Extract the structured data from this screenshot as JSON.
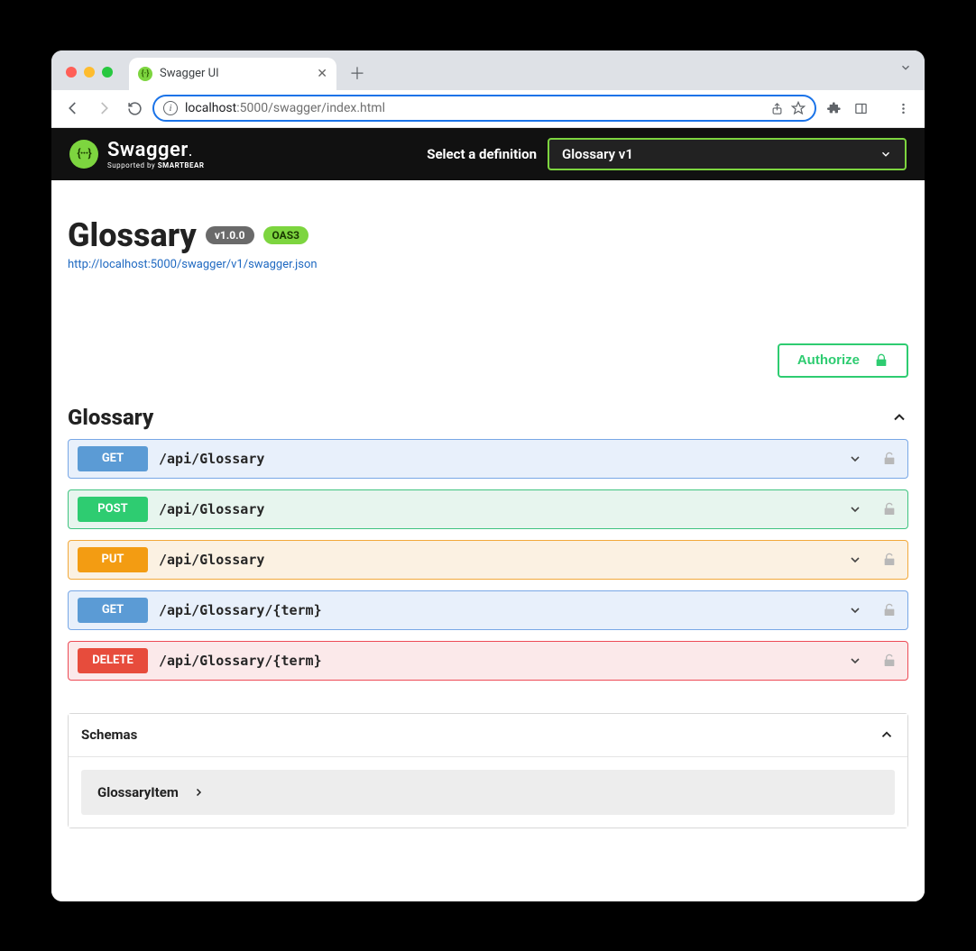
{
  "browser": {
    "tab_title": "Swagger UI",
    "url_host": "localhost",
    "url_port_path": ":5000/swagger/index.html"
  },
  "swagger_topbar": {
    "logo_text": "Swagger",
    "logo_sub_prefix": "Supported by ",
    "logo_sub_brand": "SMARTBEAR",
    "select_label": "Select a definition",
    "selected_definition": "Glossary v1"
  },
  "api": {
    "title": "Glossary",
    "version_badge": "v1.0.0",
    "oas_badge": "OAS3",
    "spec_url": "http://localhost:5000/swagger/v1/swagger.json"
  },
  "authorize_label": "Authorize",
  "tag": {
    "name": "Glossary"
  },
  "operations": [
    {
      "method": "GET",
      "css": "get",
      "path": "/api/Glossary"
    },
    {
      "method": "POST",
      "css": "post",
      "path": "/api/Glossary"
    },
    {
      "method": "PUT",
      "css": "put",
      "path": "/api/Glossary"
    },
    {
      "method": "GET",
      "css": "get",
      "path": "/api/Glossary/{term}"
    },
    {
      "method": "DELETE",
      "css": "delete",
      "path": "/api/Glossary/{term}"
    }
  ],
  "schemas": {
    "header": "Schemas",
    "items": [
      "GlossaryItem"
    ]
  }
}
